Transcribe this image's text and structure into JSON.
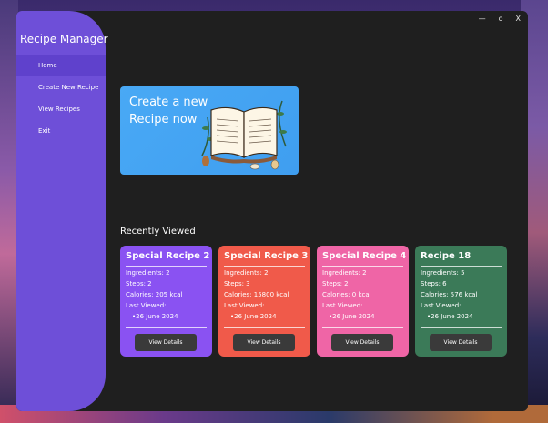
{
  "window": {
    "minimize": "—",
    "maximize": "o",
    "close": "X"
  },
  "sidebar": {
    "title": "Recipe Manager",
    "items": [
      {
        "label": "Home"
      },
      {
        "label": "Create New Recipe"
      },
      {
        "label": "View Recipes"
      },
      {
        "label": "Exit"
      }
    ]
  },
  "banner": {
    "text": "Create a new Recipe now",
    "icon": "open-book-icon"
  },
  "recent": {
    "title": "Recently Viewed",
    "cards": [
      {
        "title": "Special Recipe 2",
        "ingredients": "Ingredients: 2",
        "steps": "Steps: 2",
        "calories": "Calories: 205 kcal",
        "last_viewed_label": "Last Viewed:",
        "date": "•26 June 2024",
        "button": "View Details",
        "color": "#8a52f2"
      },
      {
        "title": "Special Recipe 3",
        "ingredients": "Ingredients: 2",
        "steps": "Steps: 3",
        "calories": "Calories: 15800 kcal",
        "last_viewed_label": "Last Viewed:",
        "date": "•26 June 2024",
        "button": "View Details",
        "color": "#f05a4a"
      },
      {
        "title": "Special Recipe 4",
        "ingredients": "Ingredients: 2",
        "steps": "Steps: 2",
        "calories": "Calories: 0 kcal",
        "last_viewed_label": "Last Viewed:",
        "date": "•26 June 2024",
        "button": "View Details",
        "color": "#ef65a6"
      },
      {
        "title": "Recipe 18",
        "ingredients": "Ingredients: 5",
        "steps": "Steps: 6",
        "calories": "Calories: 576 kcal",
        "last_viewed_label": "Last Viewed:",
        "date": "•26 June 2024",
        "button": "View Details",
        "color": "#3b7a58"
      }
    ]
  }
}
